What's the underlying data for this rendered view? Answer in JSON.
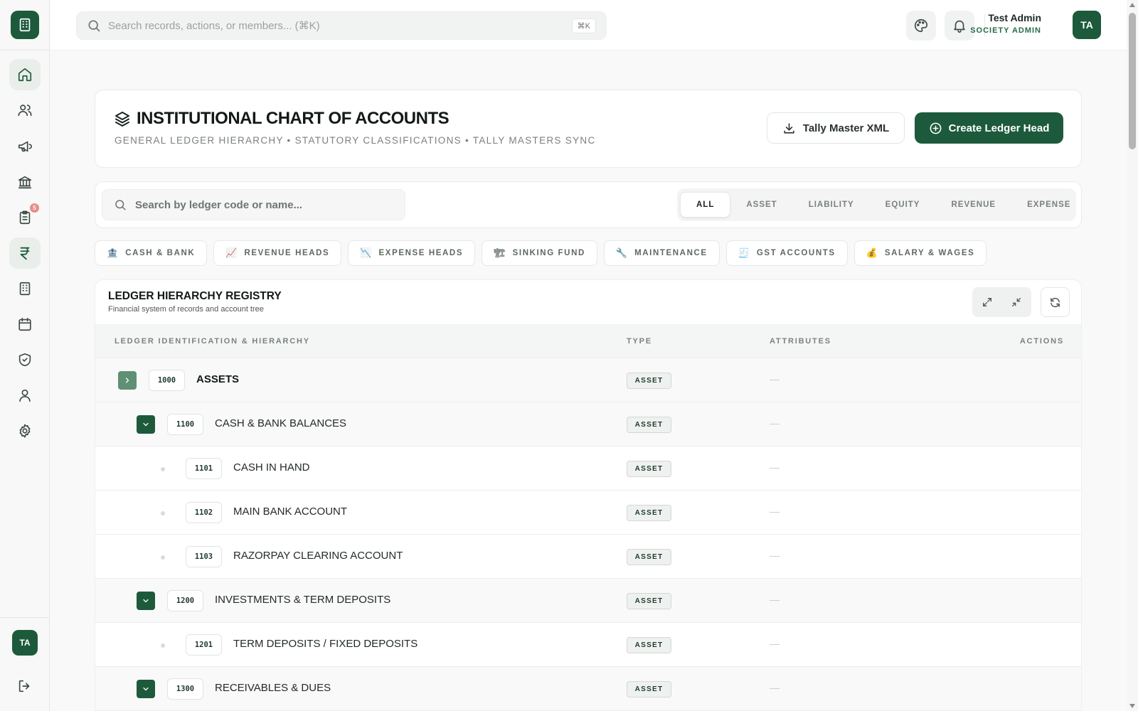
{
  "app": {
    "logo_icon": "building-icon",
    "accent": "#1d5a3c"
  },
  "topbar": {
    "search_placeholder": "Search records, actions, or members... (⌘K)",
    "search_shortcut": "⌘K",
    "user_name": "Test Admin",
    "user_role": "SOCIETY ADMIN",
    "avatar_initials": "TA"
  },
  "sidebar": {
    "items": [
      {
        "name": "home",
        "icon": "home-icon"
      },
      {
        "name": "members",
        "icon": "users-icon"
      },
      {
        "name": "announcements",
        "icon": "megaphone-icon"
      },
      {
        "name": "bank",
        "icon": "bank-icon"
      },
      {
        "name": "tasks",
        "icon": "clipboard-icon",
        "badge": "5"
      },
      {
        "name": "finance",
        "icon": "rupee-icon",
        "active": true
      },
      {
        "name": "buildings",
        "icon": "building-icon"
      },
      {
        "name": "calendar",
        "icon": "calendar-icon"
      },
      {
        "name": "security",
        "icon": "shield-check-icon"
      },
      {
        "name": "profile",
        "icon": "user-icon"
      },
      {
        "name": "settings",
        "icon": "gear-icon"
      }
    ],
    "avatar_initials": "TA",
    "logout_icon": "logout-icon"
  },
  "header": {
    "title": "INSTITUTIONAL CHART OF ACCOUNTS",
    "subtitle": "GENERAL LEDGER HIERARCHY • STATUTORY CLASSIFICATIONS • TALLY MASTERS SYNC",
    "export_label": "Tally Master XML",
    "create_label": "Create Ledger Head"
  },
  "filters": {
    "search_placeholder": "Search by ledger code or name...",
    "tabs": [
      "ALL",
      "ASSET",
      "LIABILITY",
      "EQUITY",
      "REVENUE",
      "EXPENSE"
    ],
    "active_tab": "ALL"
  },
  "chips": [
    {
      "emoji": "🏦",
      "label": "CASH & BANK"
    },
    {
      "emoji": "📈",
      "label": "REVENUE HEADS"
    },
    {
      "emoji": "📉",
      "label": "EXPENSE HEADS"
    },
    {
      "emoji": "🏗",
      "label": "SINKING FUND"
    },
    {
      "emoji": "🔧",
      "label": "MAINTENANCE"
    },
    {
      "emoji": "🧾",
      "label": "GST ACCOUNTS"
    },
    {
      "emoji": "💰",
      "label": "SALARY & WAGES"
    }
  ],
  "registry": {
    "title": "LEDGER HIERARCHY REGISTRY",
    "subtitle": "Financial system of records and account tree",
    "columns": {
      "ledger": "LEDGER IDENTIFICATION & HIERARCHY",
      "type": "TYPE",
      "attributes": "ATTRIBUTES",
      "actions": "ACTIONS"
    },
    "rows": [
      {
        "code": "1000",
        "name": "ASSETS",
        "type": "ASSET",
        "attributes": "—",
        "level": 0,
        "toggle": "collapsed"
      },
      {
        "code": "1100",
        "name": "CASH & BANK BALANCES",
        "type": "ASSET",
        "attributes": "—",
        "level": 1,
        "toggle": "expanded"
      },
      {
        "code": "1101",
        "name": "CASH IN HAND",
        "type": "ASSET",
        "attributes": "—",
        "level": 2,
        "toggle": "leaf"
      },
      {
        "code": "1102",
        "name": "MAIN BANK ACCOUNT",
        "type": "ASSET",
        "attributes": "—",
        "level": 2,
        "toggle": "leaf"
      },
      {
        "code": "1103",
        "name": "RAZORPAY CLEARING ACCOUNT",
        "type": "ASSET",
        "attributes": "—",
        "level": 2,
        "toggle": "leaf"
      },
      {
        "code": "1200",
        "name": "INVESTMENTS & TERM DEPOSITS",
        "type": "ASSET",
        "attributes": "—",
        "level": 1,
        "toggle": "expanded"
      },
      {
        "code": "1201",
        "name": "TERM DEPOSITS / FIXED DEPOSITS",
        "type": "ASSET",
        "attributes": "—",
        "level": 2,
        "toggle": "leaf"
      },
      {
        "code": "1300",
        "name": "RECEIVABLES & DUES",
        "type": "ASSET",
        "attributes": "—",
        "level": 1,
        "toggle": "expanded"
      }
    ]
  }
}
